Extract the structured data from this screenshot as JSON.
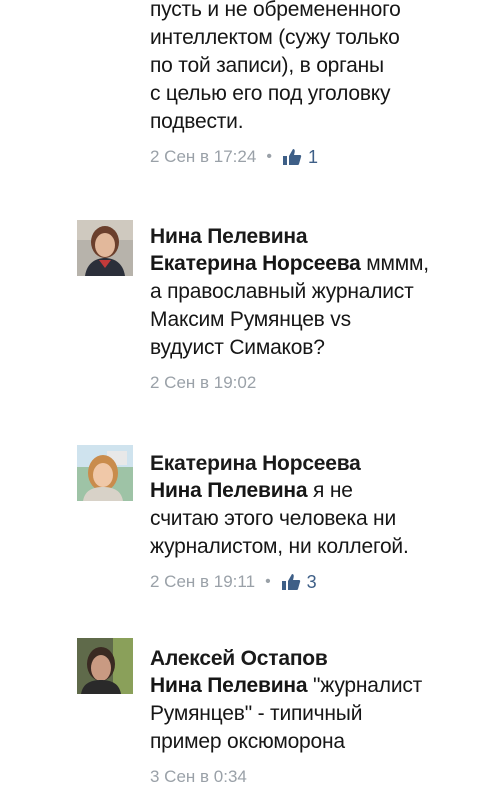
{
  "comments": [
    {
      "author": "",
      "reply_to": "",
      "text": "пусть и не обремененного\nинтеллектом (сужу только\nпо той записи), в органы\nс целью его под уголовку\nподвести.",
      "timestamp": "2 Сен в 17:24",
      "likes": "1"
    },
    {
      "author": "Нина Пелевина",
      "reply_to": "Екатерина Норсеева",
      "text": " мммм,\nа православный журналист\nМаксим Румянцев vs\nвудуист Симаков?",
      "timestamp": "2 Сен в 19:02",
      "likes": ""
    },
    {
      "author": "Екатерина Норсеева",
      "reply_to": "Нина Пелевина",
      "text": " я не\nсчитаю этого человека ни\nжурналистом, ни коллегой.",
      "timestamp": "2 Сен в 19:11",
      "likes": "3"
    },
    {
      "author": "Алексей Остапов",
      "reply_to": "Нина Пелевина",
      "text": " \"журналист\nРумянцев\" - типичный\nпример оксюморона",
      "timestamp": "3 Сен в 0:34",
      "likes": ""
    }
  ],
  "meta_separator": "•",
  "icons": {
    "like": "thumbs-up-icon",
    "avatar": "avatar"
  },
  "colors": {
    "meta": "#9aa1a8",
    "like": "#3e5f87"
  }
}
